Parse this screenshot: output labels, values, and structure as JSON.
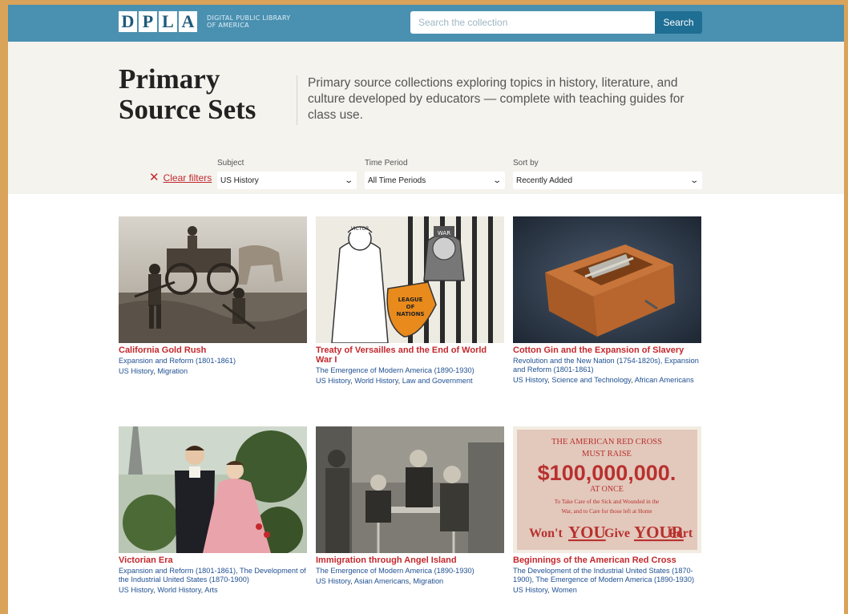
{
  "header": {
    "logo_letters": [
      "D",
      "P",
      "L",
      "A"
    ],
    "logo_text_line1": "Digital Public Library",
    "logo_text_line2": "of America",
    "search_placeholder": "Search the collection",
    "search_button": "Search"
  },
  "hero": {
    "title_line1": "Primary",
    "title_line2": "Source Sets",
    "description": "Primary source collections exploring topics in history, literature, and culture developed by educators — complete with teaching guides for class use."
  },
  "filters": {
    "clear_label": "Clear filters",
    "subject": {
      "label": "Subject",
      "value": "US History"
    },
    "time_period": {
      "label": "Time Period",
      "value": "All Time Periods"
    },
    "sort_by": {
      "label": "Sort by",
      "value": "Recently Added"
    }
  },
  "cards": [
    {
      "title": "California Gold Rush",
      "periods": "Expansion and Reform (1801-1861)",
      "tags": [
        "US History",
        "Migration"
      ]
    },
    {
      "title": "Treaty of Versailles and the End of World War I",
      "periods": "The Emergence of Modern America (1890-1930)",
      "tags": [
        "US History",
        "World History",
        "Law and Government"
      ],
      "image_text": {
        "hat": "VICTOR",
        "war": "WAR",
        "shield1": "LEAGUE",
        "shield2": "OF",
        "shield3": "NATIONS"
      }
    },
    {
      "title": "Cotton Gin and the Expansion of Slavery",
      "periods": "Revolution and the New Nation (1754-1820s), Expansion and Reform (1801-1861)",
      "tags": [
        "US History",
        "Science and Technology",
        "African Americans"
      ]
    },
    {
      "title": "Victorian Era",
      "periods": "Expansion and Reform (1801-1861), The Development of the Industrial United States (1870-1900)",
      "tags": [
        "US History",
        "World History",
        "Arts"
      ]
    },
    {
      "title": "Immigration through Angel Island",
      "periods": "The Emergence of Modern America (1890-1930)",
      "tags": [
        "US History",
        "Asian Americans",
        "Migration"
      ]
    },
    {
      "title": "Beginnings of the American Red Cross",
      "periods": "The Development of the Industrial United States (1870-1900), The Emergence of Modern America (1890-1930)",
      "tags": [
        "US History",
        "Women"
      ],
      "poster": {
        "line1": "THE AMERICAN RED CROSS",
        "line2": "MUST RAISE",
        "amount": "$100,000,000.",
        "line3": "AT ONCE",
        "line4": "To Take Care of the Sick and Wounded in the",
        "line5": "War, and to Care for those left at Home",
        "line6a": "Won't",
        "line6b": "YOU",
        "line6c": "Give",
        "line6d": "YOUR",
        "line6e": "Part"
      }
    }
  ]
}
